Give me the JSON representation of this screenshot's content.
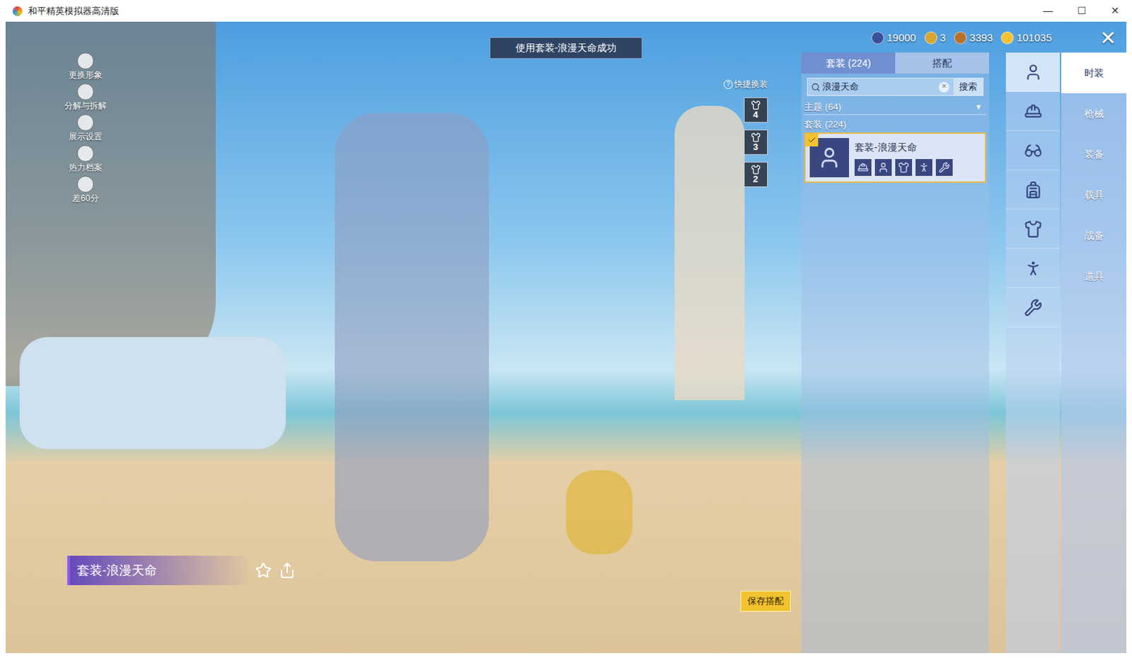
{
  "window": {
    "title": "和平精英模拟器高清版",
    "controls": [
      "—",
      "☐",
      "✕"
    ]
  },
  "toast": "使用套装-浪漫天命成功",
  "currencies": [
    {
      "amount": "19000",
      "color": "#3b4f9a"
    },
    {
      "amount": "3",
      "color": "#d9a531"
    },
    {
      "amount": "3393",
      "color": "#b8712c"
    },
    {
      "amount": "101035",
      "color": "#f2c230"
    }
  ],
  "close": "✕",
  "left_menu": [
    {
      "label": "更换形象"
    },
    {
      "label": "分解与拆解"
    },
    {
      "label": "展示设置"
    },
    {
      "label": "热力档案"
    },
    {
      "label": "差60分"
    }
  ],
  "quick_change": {
    "help": "?",
    "label": "快捷换装",
    "slots": [
      {
        "number": "4"
      },
      {
        "number": "3"
      },
      {
        "number": "2"
      }
    ]
  },
  "panel": {
    "tabs": [
      {
        "label": "套装 (224)",
        "selected": true
      },
      {
        "label": "搭配",
        "selected": false
      }
    ],
    "search": {
      "value": "浪漫天命",
      "clear": "✕",
      "button": "搜索"
    },
    "filter": {
      "label": "主题 (64)",
      "arrow": "▼"
    },
    "section": "套装 (224)",
    "items": [
      {
        "name": "套装-浪漫天命",
        "checked": true
      }
    ]
  },
  "categories": [
    {
      "selected": true
    },
    {
      "selected": false
    },
    {
      "selected": false
    },
    {
      "selected": false
    },
    {
      "selected": false
    },
    {
      "selected": false
    },
    {
      "selected": false
    }
  ],
  "main_tabs": [
    {
      "label": "时装",
      "selected": true
    },
    {
      "label": "枪械",
      "selected": false
    },
    {
      "label": "装备",
      "selected": false
    },
    {
      "label": "载具",
      "selected": false
    },
    {
      "label": "战备",
      "selected": false
    },
    {
      "label": "道具",
      "selected": false
    }
  ],
  "outfit_label": "套装-浪漫天命",
  "save_button": "保存搭配"
}
